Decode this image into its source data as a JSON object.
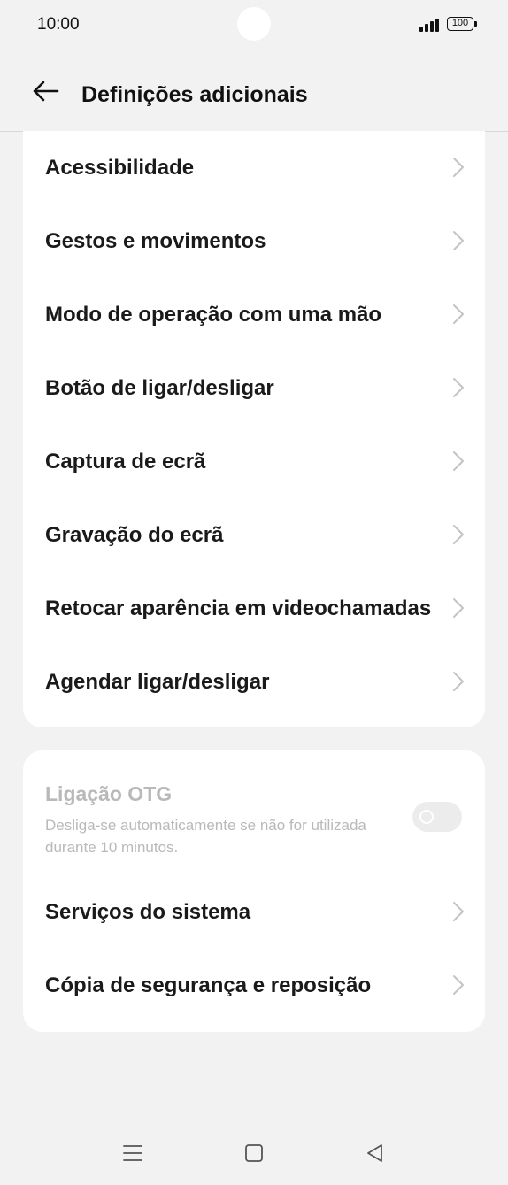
{
  "status_bar": {
    "time": "10:00",
    "battery": "100"
  },
  "header": {
    "title": "Definições adicionais"
  },
  "group1": {
    "items": [
      {
        "label": "Acessibilidade"
      },
      {
        "label": "Gestos e movimentos"
      },
      {
        "label": "Modo de operação com uma mão"
      },
      {
        "label": "Botão de ligar/desligar"
      },
      {
        "label": "Captura de ecrã"
      },
      {
        "label": "Gravação do ecrã"
      },
      {
        "label": "Retocar aparência em videochamadas"
      },
      {
        "label": "Agendar ligar/desligar"
      }
    ]
  },
  "group2": {
    "otg": {
      "title": "Ligação OTG",
      "description": "Desliga-se automaticamente se não for utilizada durante 10 minutos.",
      "enabled": false
    },
    "items": [
      {
        "label": "Serviços do sistema"
      },
      {
        "label": "Cópia de segurança e reposição"
      }
    ]
  },
  "icons": {
    "back": "arrow-left-icon",
    "chevron": "chevron-right-icon",
    "nav_menu": "menu-icon",
    "nav_home": "home-square-icon",
    "nav_back": "back-triangle-icon"
  },
  "colors": {
    "background": "#f2f2f2",
    "card": "#ffffff",
    "text": "#1a1a1a",
    "disabled_text": "#b9b9b9",
    "chevron": "#c4c4c4"
  }
}
